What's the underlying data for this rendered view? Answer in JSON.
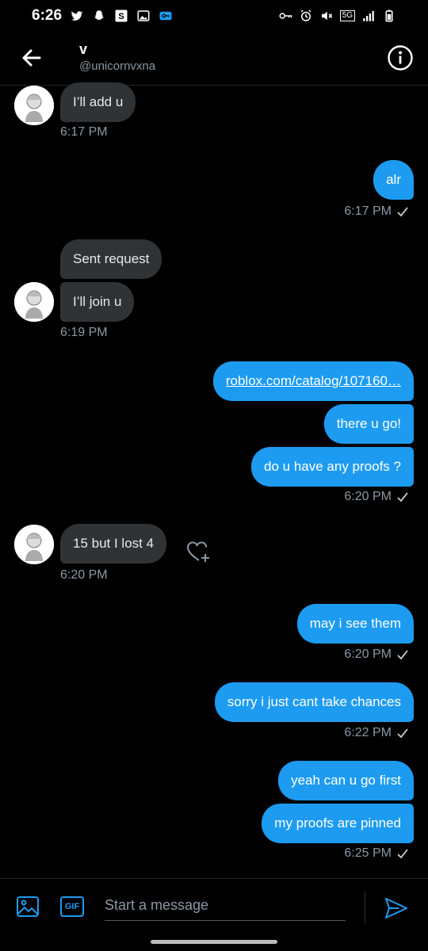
{
  "status_bar": {
    "time": "6:26",
    "network_label": "5G"
  },
  "header": {
    "name": "v",
    "handle": "@unicornvxna"
  },
  "messages": [
    {
      "dir": "in",
      "text": "I’ll add u"
    },
    {
      "dir": "in",
      "time": "6:17 PM"
    },
    {
      "dir": "out",
      "text": "alr",
      "time": "6:17 PM"
    },
    {
      "dir": "in",
      "text": "Sent request"
    },
    {
      "dir": "in",
      "text": "I’ll join u",
      "time": "6:19 PM"
    },
    {
      "dir": "out",
      "text": "roblox.com/catalog/107160…"
    },
    {
      "dir": "out",
      "text": "there u go!"
    },
    {
      "dir": "out",
      "text": "do u have any proofs ?",
      "time": "6:20 PM"
    },
    {
      "dir": "in",
      "text": "15 but I lost 4",
      "time": "6:20 PM"
    },
    {
      "dir": "out",
      "text": "may i see them",
      "time": "6:20 PM"
    },
    {
      "dir": "out",
      "text": "sorry i just cant take chances",
      "time": "6:22 PM"
    },
    {
      "dir": "out",
      "text": "yeah can u go first"
    },
    {
      "dir": "out",
      "text": "my proofs are pinned",
      "time": "6:25 PM"
    }
  ],
  "composer": {
    "placeholder": "Start a message",
    "gif_label": "GIF"
  },
  "colors": {
    "accent": "#1d9bf0",
    "incoming_bubble": "#2f3336",
    "background": "#000000"
  }
}
